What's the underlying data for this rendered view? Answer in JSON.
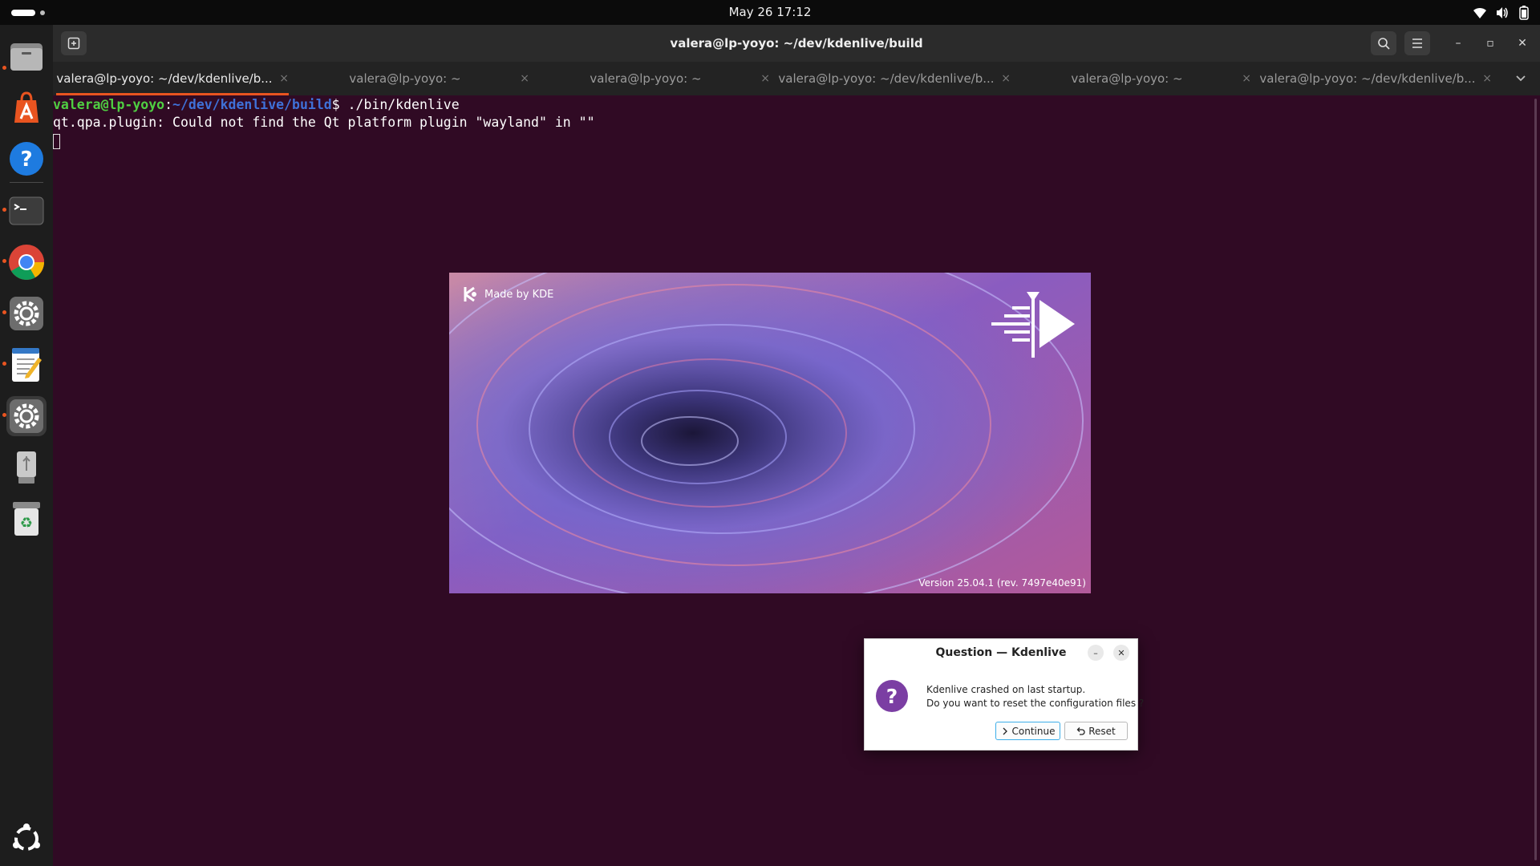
{
  "topbar": {
    "clock": "May 26  17:12",
    "tray_icons": [
      "wifi-icon",
      "volume-icon",
      "battery-icon"
    ]
  },
  "dock": {
    "items": [
      {
        "name": "files-icon",
        "running": true
      },
      {
        "name": "app-center-icon",
        "running": false
      },
      {
        "name": "help-icon",
        "running": false
      },
      {
        "name": "terminal-icon",
        "running": true
      },
      {
        "name": "chrome-icon",
        "running": true
      },
      {
        "name": "settings-icon",
        "running": true
      },
      {
        "name": "text-editor-icon",
        "running": true
      },
      {
        "name": "kdenlive-settings-icon",
        "running": true,
        "active": true
      },
      {
        "name": "usb-drive-icon",
        "running": false
      },
      {
        "name": "trash-icon",
        "running": false
      },
      {
        "name": "show-apps-icon",
        "running": false
      }
    ]
  },
  "terminal": {
    "title": "valera@lp-yoyo: ~/dev/kdenlive/build",
    "tabs": [
      {
        "label": "valera@lp-yoyo: ~/dev/kdenlive/b...",
        "close": "×",
        "active": true
      },
      {
        "label": "valera@lp-yoyo: ~",
        "close": "×",
        "active": false
      },
      {
        "label": "valera@lp-yoyo: ~",
        "close": "×",
        "active": false
      },
      {
        "label": "valera@lp-yoyo: ~/dev/kdenlive/b...",
        "close": "×",
        "active": false
      },
      {
        "label": "valera@lp-yoyo: ~",
        "close": "×",
        "active": false
      },
      {
        "label": "valera@lp-yoyo: ~/dev/kdenlive/b...",
        "close": "×",
        "active": false
      }
    ],
    "prompt_user": "valera@lp-yoyo",
    "prompt_sep": ":",
    "prompt_path": "~/dev/kdenlive/build",
    "prompt_dollar": "$ ",
    "command": "./bin/kdenlive",
    "output": "qt.qpa.plugin: Could not find the Qt platform plugin \"wayland\" in \"\"",
    "window_controls": {
      "minimize": "–",
      "maximize": "▫",
      "close": "✕"
    }
  },
  "splash": {
    "made_by": "Made by KDE",
    "version": "Version 25.04.1 (rev. 7497e40e91)"
  },
  "dialog": {
    "title": "Question — Kdenlive",
    "minimize": "–",
    "close": "✕",
    "line1": "Kdenlive crashed on last startup.",
    "line2": "Do you want to reset the configuration files ?",
    "continue_label": "Continue",
    "reset_label": "Reset"
  },
  "colors": {
    "accent": "#e95420",
    "terminal_bg": "#300a24",
    "prompt_user": "#4fcf42",
    "prompt_path": "#3f71d8",
    "dialog_icon": "#7b3ea3"
  }
}
